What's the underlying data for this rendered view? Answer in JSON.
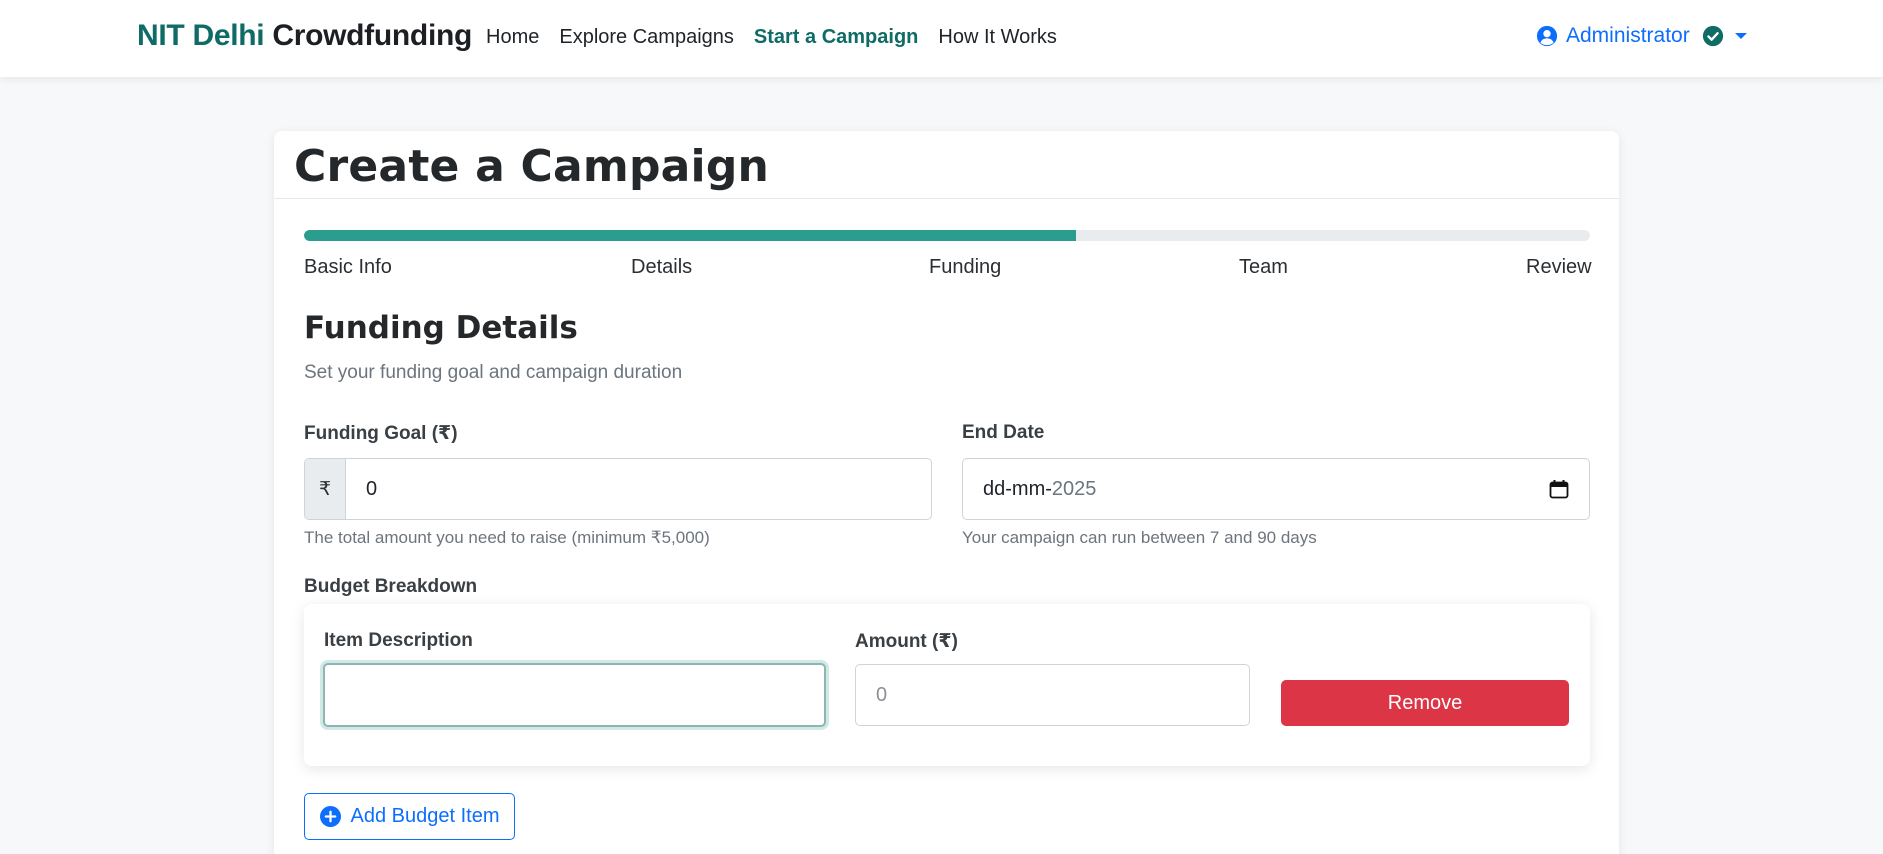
{
  "navbar": {
    "brand_accent": "NIT Delhi",
    "brand_rest": "Crowdfunding",
    "links": [
      "Home",
      "Explore Campaigns",
      "Start a Campaign",
      "How It Works"
    ],
    "active_link": "Start a Campaign",
    "user_name": "Administrator",
    "user_icon": "user-circle-icon",
    "verified_icon": "check-circle-icon",
    "caret_icon": "caret-down-icon"
  },
  "page": {
    "title": "Create a Campaign",
    "progress_percent": 60,
    "steps": [
      "Basic Info",
      "Details",
      "Funding",
      "Team",
      "Review"
    ]
  },
  "section": {
    "title": "Funding Details",
    "subtitle": "Set your funding goal and campaign duration"
  },
  "funding_goal": {
    "label": "Funding Goal (₹)",
    "prefix": "₹",
    "value": "0",
    "help": "The total amount you need to raise (minimum ₹5,000)"
  },
  "end_date": {
    "label": "End Date",
    "value_prefix": "dd-mm-",
    "value_year": "2025",
    "help": "Your campaign can run between 7 and 90 days",
    "icon": "calendar-icon"
  },
  "budget": {
    "label": "Budget Breakdown",
    "item_label": "Item Description",
    "item_value": "",
    "amount_label": "Amount (₹)",
    "amount_placeholder": "0",
    "remove_label": "Remove",
    "add_label": "Add Budget Item",
    "add_icon": "plus-circle-icon"
  },
  "colors": {
    "brand": "#0f6b66",
    "progress": "#2a9d8f",
    "primary": "#0d6efd",
    "danger": "#dc3545"
  }
}
